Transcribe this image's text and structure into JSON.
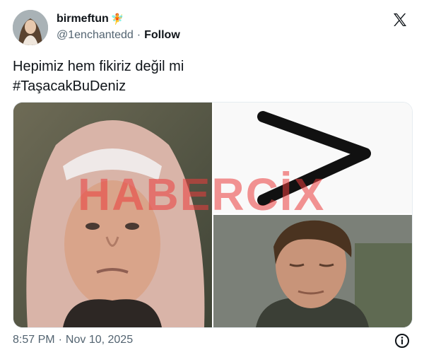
{
  "author": {
    "display_name": "birmeftun",
    "name_emoji": "🧚",
    "handle": "@1enchantedd",
    "separator": "·",
    "follow_label": "Follow"
  },
  "tweet": {
    "text_line1": "Hepimiz hem fikiriz değil mi",
    "hashtag": "#TaşacakBuDeniz"
  },
  "media": {
    "watermark": "HABERCİX"
  },
  "footer": {
    "time": "8:57 PM",
    "separator": "·",
    "date": "Nov 10, 2025"
  },
  "icons": {
    "logo": "x-logo-icon",
    "info": "info-icon"
  }
}
